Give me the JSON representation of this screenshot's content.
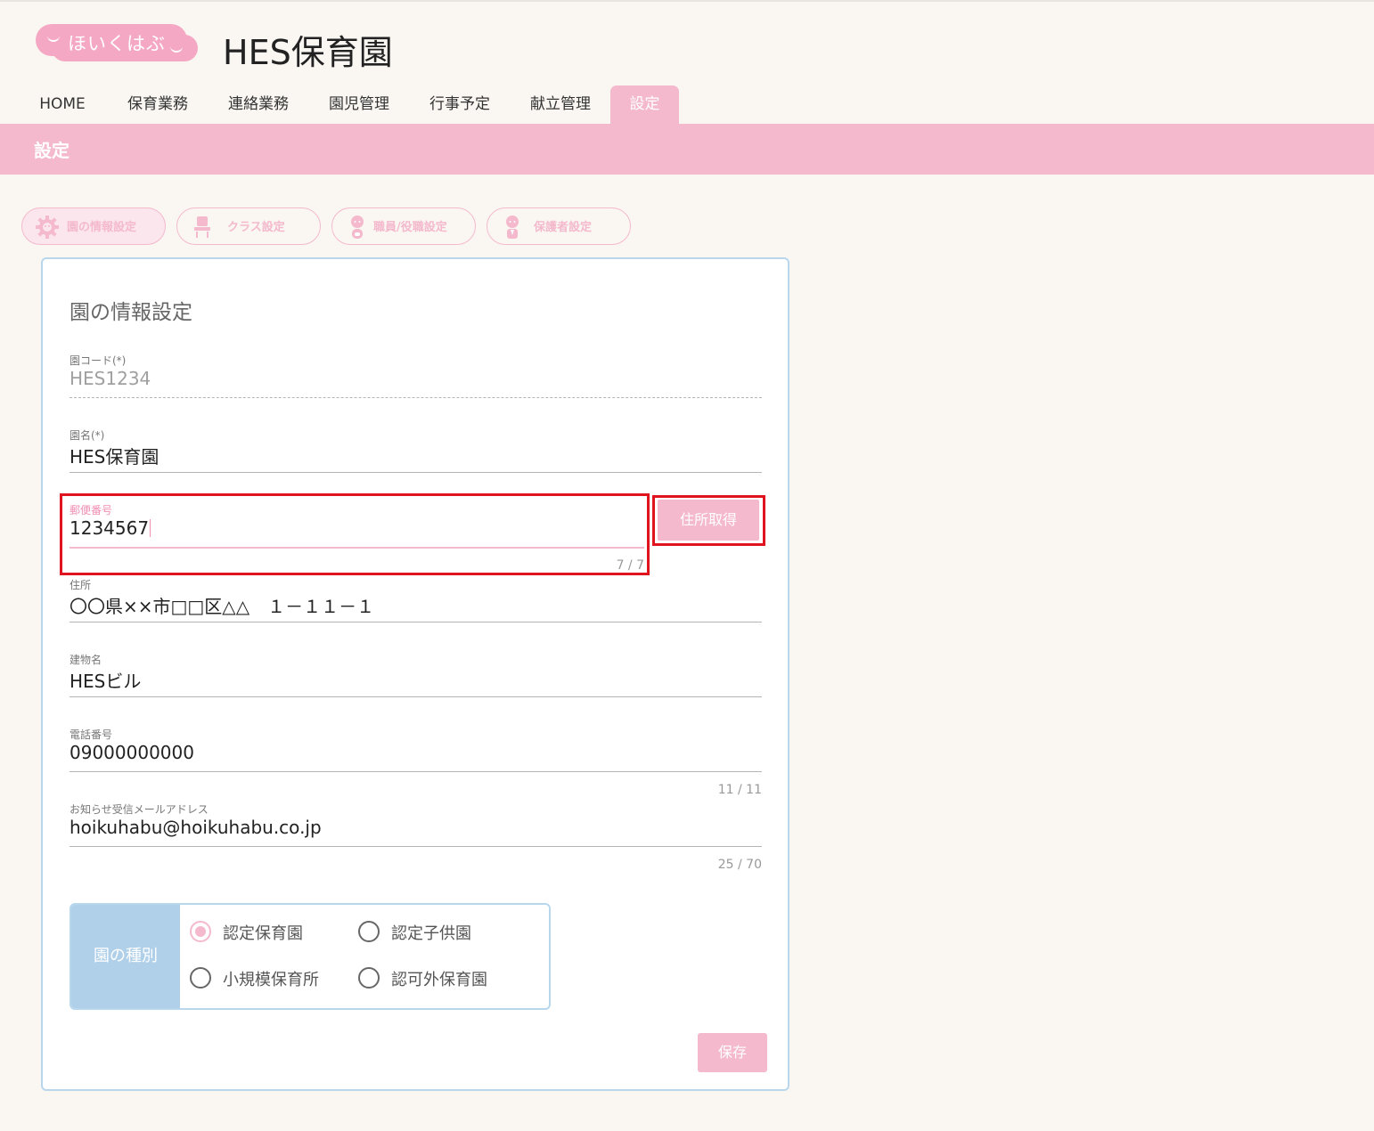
{
  "header": {
    "logo_text": "ほいくはぶ",
    "site_title": "HES保育園"
  },
  "nav": {
    "tabs": [
      {
        "label": "HOME"
      },
      {
        "label": "保育業務"
      },
      {
        "label": "連絡業務"
      },
      {
        "label": "園児管理"
      },
      {
        "label": "行事予定"
      },
      {
        "label": "献立管理"
      },
      {
        "label": "設定"
      }
    ],
    "active": "設定"
  },
  "page": {
    "section_title": "設定"
  },
  "subtabs": [
    {
      "label": "園の情報設定",
      "icon": "gear-icon"
    },
    {
      "label": "クラス設定",
      "icon": "class-icon"
    },
    {
      "label": "職員/役職設定",
      "icon": "staff-icon"
    },
    {
      "label": "保護者設定",
      "icon": "guardian-icon"
    }
  ],
  "form": {
    "title": "園の情報設定",
    "code": {
      "label": "園コード(*)",
      "value": "HES1234"
    },
    "name": {
      "label": "園名(*)",
      "value": "HES保育園"
    },
    "postal": {
      "label": "郵便番号",
      "value": "1234567",
      "counter": "7 / 7"
    },
    "address_button": "住所取得",
    "address": {
      "label": "住所",
      "value": "〇〇県××市□□区△△　１－１１－１"
    },
    "building": {
      "label": "建物名",
      "value": "HESビル"
    },
    "phone": {
      "label": "電話番号",
      "value": "09000000000",
      "counter": "11 / 11"
    },
    "email": {
      "label": "お知らせ受信メールアドレス",
      "value": "hoikuhabu@hoikuhabu.co.jp",
      "counter": "25 / 70"
    },
    "type": {
      "label": "園の種別",
      "options": [
        "認定保育園",
        "認定子供園",
        "小規模保育所",
        "認可外保育園"
      ],
      "selected": "認定保育園"
    },
    "save_button": "保存"
  },
  "colors": {
    "accent_pink": "#f4b9cd",
    "logo_pink": "#f4a8c3",
    "card_border": "#b9d7ec",
    "type_header": "#b0d0ea",
    "highlight_red": "#e0141e"
  }
}
